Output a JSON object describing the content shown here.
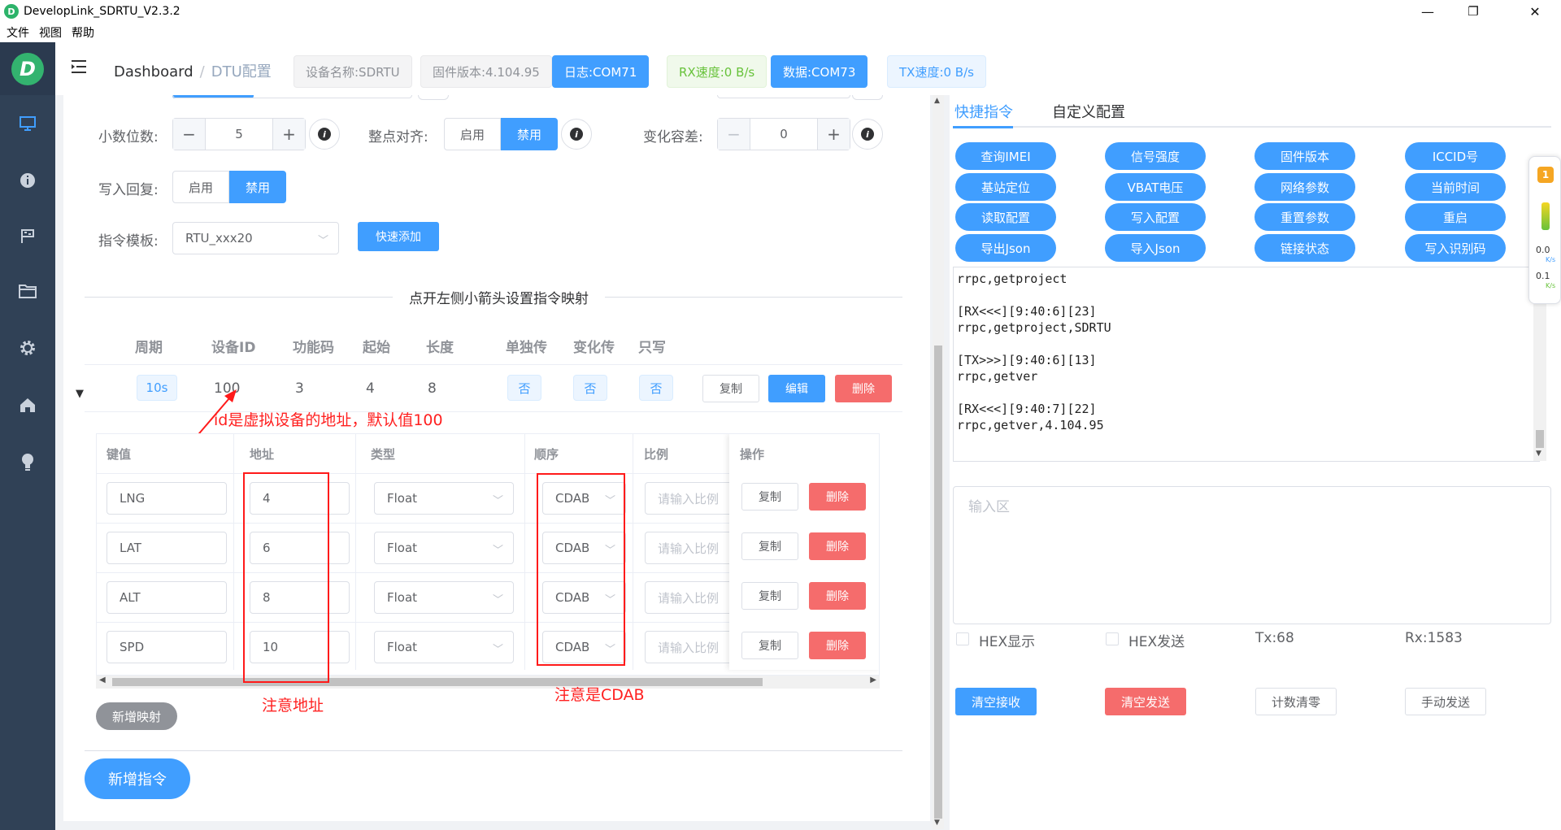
{
  "window": {
    "title": "DevelopLink_SDRTU_V2.3.2",
    "minimize": "—",
    "maximize": "❐",
    "close": "✕"
  },
  "menu": [
    "文件",
    "视图",
    "帮助"
  ],
  "breadcrumb": {
    "home": "Dashboard",
    "sep": "/",
    "current": "DTU配置"
  },
  "header_tags": {
    "device_name": "设备名称:SDRTU",
    "firmware": "固件版本:4.104.95",
    "log_port": "日志:COM71",
    "rx_speed": "RX速度:0 B/s",
    "data_port": "数据:COM73",
    "tx_speed": "TX速度:0 B/s"
  },
  "colors": {
    "primary": "#409eff",
    "success": "#67c23a",
    "danger": "#f56c6c",
    "sidebar": "#304156",
    "annotation": "#ff1a1a"
  },
  "form": {
    "decimal_label": "小数位数:",
    "decimal_value": "5",
    "align_label": "整点对齐:",
    "align_on": "启用",
    "align_off": "禁用",
    "tolerance_label": "变化容差:",
    "tolerance_value": "0",
    "write_reply_label": "写入回复:",
    "write_on": "启用",
    "write_off": "禁用",
    "template_label": "指令模板:",
    "template_value": "RTU_xxx20",
    "quick_add": "快速添加",
    "stepper_minus": "−",
    "stepper_plus": "+",
    "info_glyph": "i"
  },
  "divider_text": "点开左侧小箭头设置指令映射",
  "command_table": {
    "headers": [
      "周期",
      "设备ID",
      "功能码",
      "起始",
      "长度",
      "单独传",
      "变化传",
      "只写"
    ],
    "row": {
      "period": "10s",
      "device_id": "100",
      "func": "3",
      "start": "4",
      "length": "8",
      "single": "否",
      "change": "否",
      "write_only": "否"
    },
    "buttons": {
      "copy": "复制",
      "edit": "编辑",
      "delete": "删除"
    }
  },
  "mapping_table": {
    "headers": [
      "键值",
      "地址",
      "类型",
      "顺序",
      "比例",
      "操作"
    ],
    "rows": [
      {
        "key": "LNG",
        "addr": "4",
        "type": "Float",
        "order": "CDAB",
        "ratio": "请输入比例"
      },
      {
        "key": "LAT",
        "addr": "6",
        "type": "Float",
        "order": "CDAB",
        "ratio": "请输入比例"
      },
      {
        "key": "ALT",
        "addr": "8",
        "type": "Float",
        "order": "CDAB",
        "ratio": "请输入比例"
      },
      {
        "key": "SPD",
        "addr": "10",
        "type": "Float",
        "order": "CDAB",
        "ratio": "请输入比例"
      }
    ],
    "copy": "复制",
    "delete": "删除"
  },
  "add_mapping": "新增映射",
  "add_command": "新增指令",
  "annotations": {
    "id_note": "id是虚拟设备的地址，默认值100",
    "addr_note": "注意地址",
    "order_note": "注意是CDAB"
  },
  "tabs": {
    "quick": "快捷指令",
    "custom": "自定义配置"
  },
  "quick_buttons": [
    "查询IMEI",
    "信号强度",
    "固件版本",
    "ICCID号",
    "基站定位",
    "VBAT电压",
    "网络参数",
    "当前时间",
    "读取配置",
    "写入配置",
    "重置参数",
    "重启",
    "导出Json",
    "导入Json",
    "链接状态",
    "写入识别码"
  ],
  "log_text": "rrpc,getproject\n\n[RX<<<][9:40:6][23]\nrrpc,getproject,SDRTU\n\n[TX>>>][9:40:6][13]\nrrpc,getver\n\n[RX<<<][9:40:7][22]\nrrpc,getver,4.104.95",
  "input_placeholder": "输入区",
  "options": {
    "hex_display": "HEX显示",
    "hex_send": "HEX发送",
    "tx": "Tx:68",
    "rx": "Rx:1583"
  },
  "actions": {
    "clear_rx": "清空接收",
    "clear_tx": "清空发送",
    "reset_count": "计数清零",
    "manual_send": "手动发送"
  },
  "float_widget": {
    "badge": "1",
    "up_speed": "0.0",
    "up_unit": "K/s",
    "down_speed": "0.1",
    "down_unit": "K/s"
  }
}
